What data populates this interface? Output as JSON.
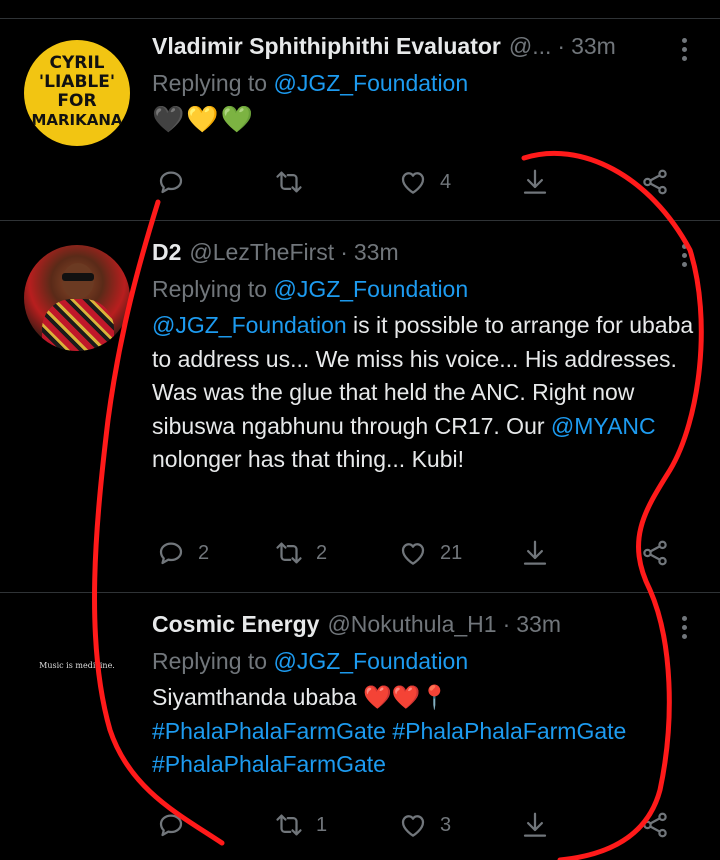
{
  "tweets": [
    {
      "name": "Vladimir Sphithiphithi Evaluator",
      "handle": "@...",
      "time": "33m",
      "replying_prefix": "Replying to",
      "replying_to": "@JGZ_Foundation",
      "emojis": "🖤💛💚",
      "avatar_lines": [
        "CYRIL",
        "'LIABLE'",
        "FOR",
        "MARIKANA"
      ],
      "counts": {
        "reply": "",
        "retweet": "",
        "like": "4"
      }
    },
    {
      "name": "D2",
      "handle": "@LezTheFirst",
      "time": "33m",
      "replying_prefix": "Replying to",
      "replying_to": "@JGZ_Foundation",
      "text_mention": "@JGZ_Foundation",
      "text_part1": " is it possible to arrange for ubaba to address us... We miss his voice... His addresses. Was was the glue that held the ANC. Right now sibuswa ngabhunu through CR17. Our ",
      "text_mention2": "@MYANC",
      "text_part2": " nolonger has that thing... Kubi!",
      "counts": {
        "reply": "2",
        "retweet": "2",
        "like": "21"
      }
    },
    {
      "name": "Cosmic Energy",
      "handle": "@Nokuthula_H1",
      "time": "33m",
      "replying_prefix": "Replying to",
      "replying_to": "@JGZ_Foundation",
      "text": "Siyamthanda ubaba ❤️❤️📍",
      "hashtag1": "#PhalaPhalaFarmGate",
      "hashtag2": "#PhalaPhalaFarmGate",
      "hashtag3": "#PhalaPhalaFarmGate",
      "avatar_caption": "Music is medicine.",
      "counts": {
        "reply": "",
        "retweet": "1",
        "like": "3"
      }
    }
  ],
  "colors": {
    "background": "#000000",
    "text": "#e7e9ea",
    "muted": "#71767b",
    "link": "#1d9bf0",
    "annotation": "#ff1a1a"
  }
}
